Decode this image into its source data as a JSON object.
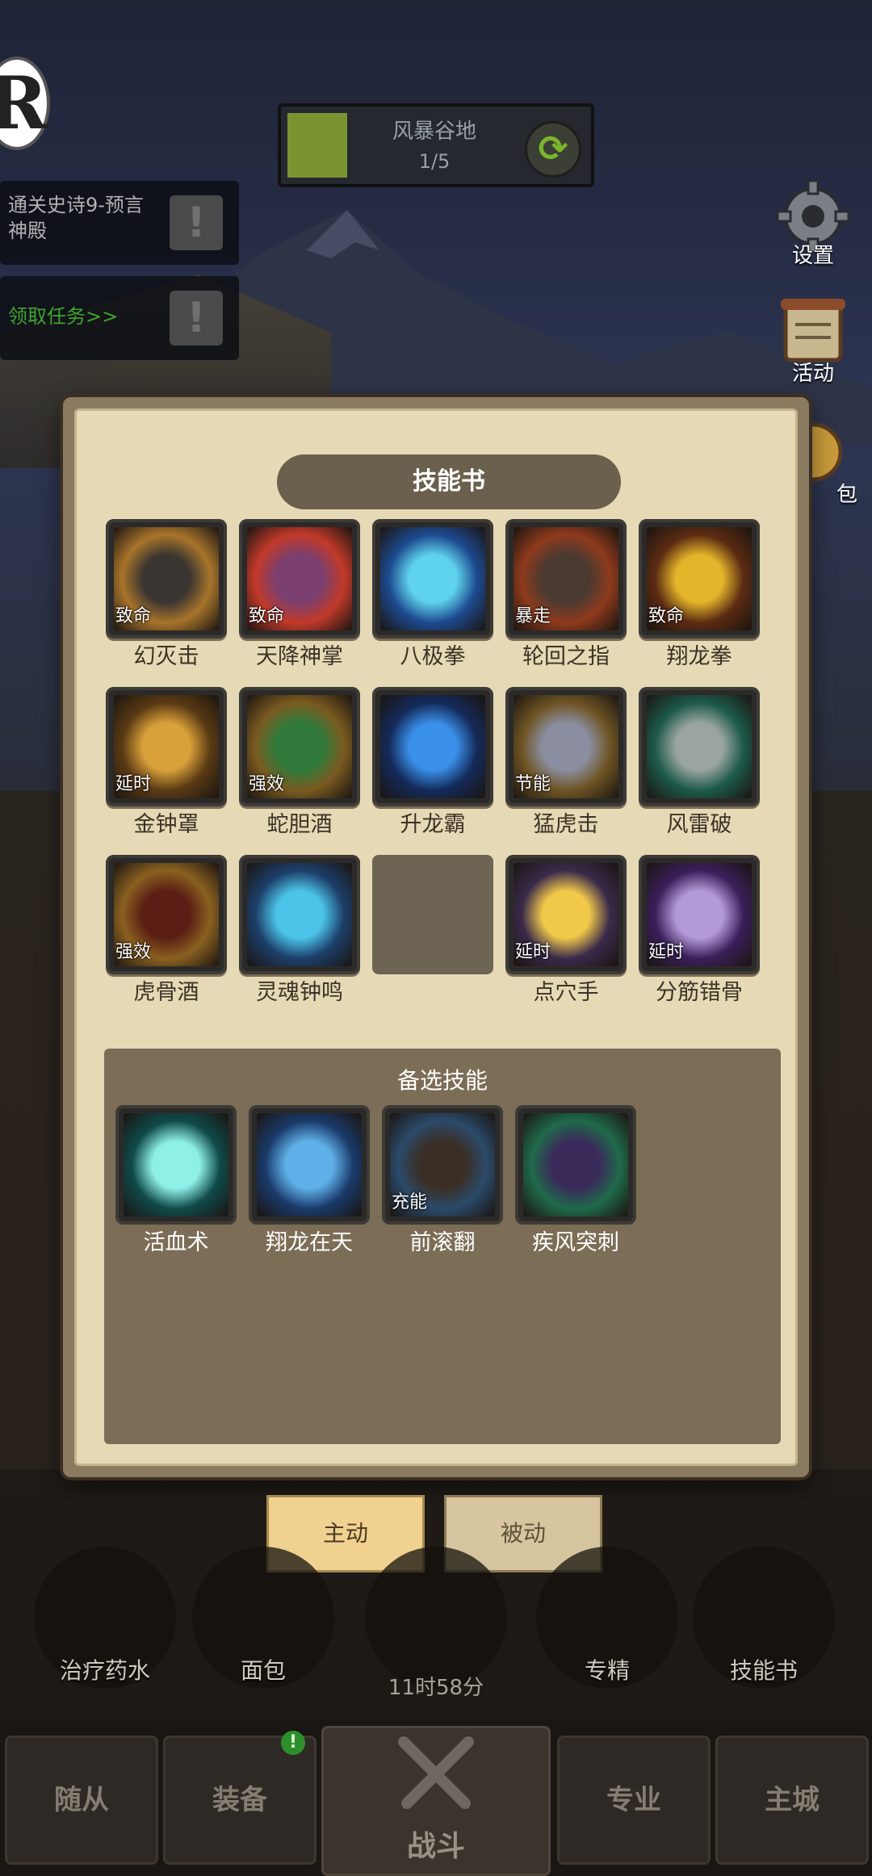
{
  "hud": {
    "logo": "R",
    "stage": {
      "name": "风暴谷地",
      "progress": "1/5",
      "fill_fraction": 0.2
    },
    "quests": [
      {
        "text": "通关史诗9-预言神殿",
        "alert": "!"
      },
      {
        "text": "领取任务>>",
        "alert": "!"
      }
    ],
    "side": {
      "settings": "设置",
      "activity": "活动",
      "bag": "包"
    }
  },
  "dialog": {
    "title": "技能书",
    "equipped": [
      {
        "name": "幻灭击",
        "tag": "致命",
        "icon": "fist-icon"
      },
      {
        "name": "天降神掌",
        "tag": "致命",
        "icon": "palm-icon"
      },
      {
        "name": "八极拳",
        "tag": "",
        "icon": "lightning-fist-icon"
      },
      {
        "name": "轮回之指",
        "tag": "暴走",
        "icon": "finger-icon"
      },
      {
        "name": "翔龙拳",
        "tag": "致命",
        "icon": "dragon-mask-icon"
      },
      {
        "name": "金钟罩",
        "tag": "延时",
        "icon": "golden-bell-icon"
      },
      {
        "name": "蛇胆酒",
        "tag": "强效",
        "icon": "snake-wine-icon"
      },
      {
        "name": "升龙霸",
        "tag": "",
        "icon": "rising-dragon-icon"
      },
      {
        "name": "猛虎击",
        "tag": "节能",
        "icon": "tiger-fist-icon"
      },
      {
        "name": "风雷破",
        "tag": "",
        "icon": "thunder-fist-icon"
      },
      {
        "name": "虎骨酒",
        "tag": "强效",
        "icon": "wine-jar-icon"
      },
      {
        "name": "灵魂钟鸣",
        "tag": "",
        "icon": "soul-bell-icon"
      },
      {
        "name": "",
        "tag": "",
        "icon": "empty-slot"
      },
      {
        "name": "点穴手",
        "tag": "延时",
        "icon": "pressure-point-icon"
      },
      {
        "name": "分筋错骨",
        "tag": "延时",
        "icon": "bone-break-icon"
      }
    ],
    "alternate": {
      "title": "备选技能",
      "skills": [
        {
          "name": "活血术",
          "tag": "",
          "icon": "healing-hand-icon"
        },
        {
          "name": "翔龙在天",
          "tag": "",
          "icon": "dragon-head-icon"
        },
        {
          "name": "前滚翻",
          "tag": "充能",
          "icon": "roll-icon"
        },
        {
          "name": "疾风突刺",
          "tag": "",
          "icon": "dash-icon"
        }
      ]
    }
  },
  "tabs": {
    "active": "主动",
    "passive": "被动"
  },
  "items": [
    {
      "label": "治疗药水",
      "icon": "potion-icon"
    },
    {
      "label": "面包",
      "icon": "bread-icon"
    },
    {
      "label": "",
      "icon": "chest-icon"
    },
    {
      "label": "专精",
      "icon": "mastery-icon"
    },
    {
      "label": "技能书",
      "icon": "skill-book-icon"
    }
  ],
  "timer": "11时58分",
  "nav": {
    "followers": "随从",
    "equipment": "装备",
    "equipment_badge": "!",
    "battle": "战斗",
    "profession": "专业",
    "city": "主城"
  },
  "colors": {
    "accent_tab": "#f0d190",
    "parchment": "#e6d9b5",
    "alt_panel": "#7c6d56",
    "quest_green": "#3fa52c"
  }
}
